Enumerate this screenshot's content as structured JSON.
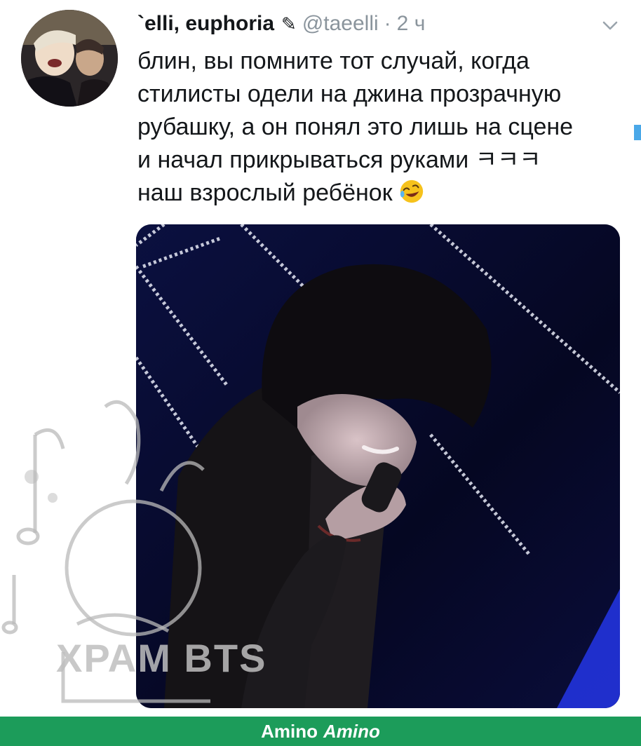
{
  "tweet": {
    "display_name": "`elli, euphoria",
    "handle": "@taeelli",
    "separator": "·",
    "time": "2 ч",
    "lines": [
      "блин, вы помните тот случай, когда",
      "стилисты одели на джина прозрачную",
      "рубашку, а он понял это лишь на сцене",
      "и начал прикрываться руками ㅋㅋㅋ",
      "наш взрослый ребёнок"
    ],
    "icons": {
      "verified_mark": "pencil-icon",
      "menu": "chevron-down-icon",
      "emoji": "laughing-face-emoji"
    }
  },
  "watermark": {
    "text": "ХРАМ BTS"
  },
  "footer": {
    "brand": "Amino",
    "brand_logo": "Amino"
  },
  "colors": {
    "footer_bg": "#1c9c5a",
    "muted_text": "#8a949c",
    "accent": "#4aa8e8"
  }
}
